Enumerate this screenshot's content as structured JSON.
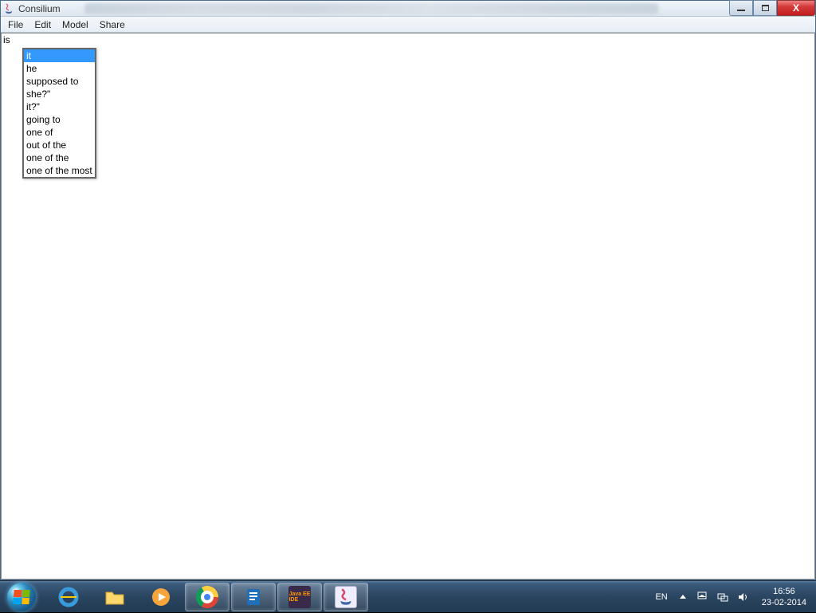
{
  "window": {
    "title": "Consilium"
  },
  "menubar": [
    "File",
    "Edit",
    "Model",
    "Share"
  ],
  "editor": {
    "typed": "is"
  },
  "suggestions": {
    "selected_index": 0,
    "items": [
      "it",
      "he",
      "supposed to",
      "she?\"",
      "it?\"",
      "going to",
      "one of",
      "out of the",
      "one of the",
      "one of the most"
    ]
  },
  "systray": {
    "lang": "EN",
    "time": "16:56",
    "date": "23-02-2014"
  }
}
